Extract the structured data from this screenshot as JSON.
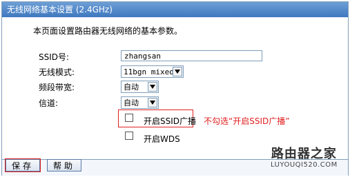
{
  "window": {
    "title": "无线网络基本设置 (2.4GHz)"
  },
  "intro": "本页面设置路由器无线网络的基本参数。",
  "form": {
    "ssid_label": "SSID号:",
    "ssid_value": "zhangsan",
    "mode_label": "无线模式:",
    "mode_value": "11bgn mixed",
    "bandwidth_label": "频段带宽:",
    "bandwidth_value": "自动",
    "channel_label": "信道:",
    "channel_value": "自动",
    "ssid_broadcast_label": "开启SSID广播",
    "ssid_broadcast_checked": false,
    "wds_label": "开启WDS",
    "wds_checked": false
  },
  "annotation": "不勾选“开启SSID广播”",
  "buttons": {
    "save": "保存",
    "help": "帮助"
  },
  "watermark": {
    "title": "路由器之家",
    "url": "LUYOUQI520.COM"
  },
  "colors": {
    "titlebar": "#4a82c6",
    "annotation": "#e02020",
    "border": "#7f9db9"
  }
}
